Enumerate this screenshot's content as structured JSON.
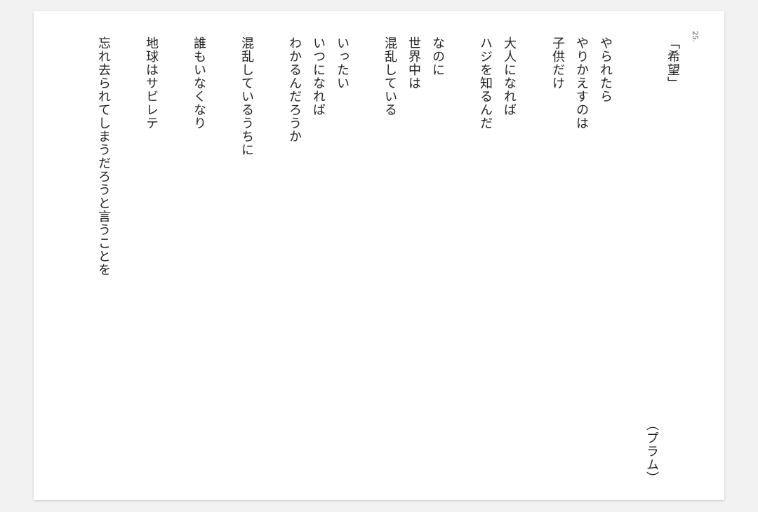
{
  "poem": {
    "number": "25.",
    "title": "「希望」",
    "author": "（プラム）",
    "lines": [
      "やられたら",
      "やりかえすのは",
      "子供だけ",
      "大人になれば",
      "ハジを知るんだ",
      "なのに",
      "世界中は",
      "混乱している",
      "いったい",
      "いつになれば",
      "わかるんだろうか",
      "混乱しているうちに",
      "誰もいなくなり",
      "地球はサビレテ",
      "忘れ去られてしまうだろうと言うことを"
    ]
  }
}
